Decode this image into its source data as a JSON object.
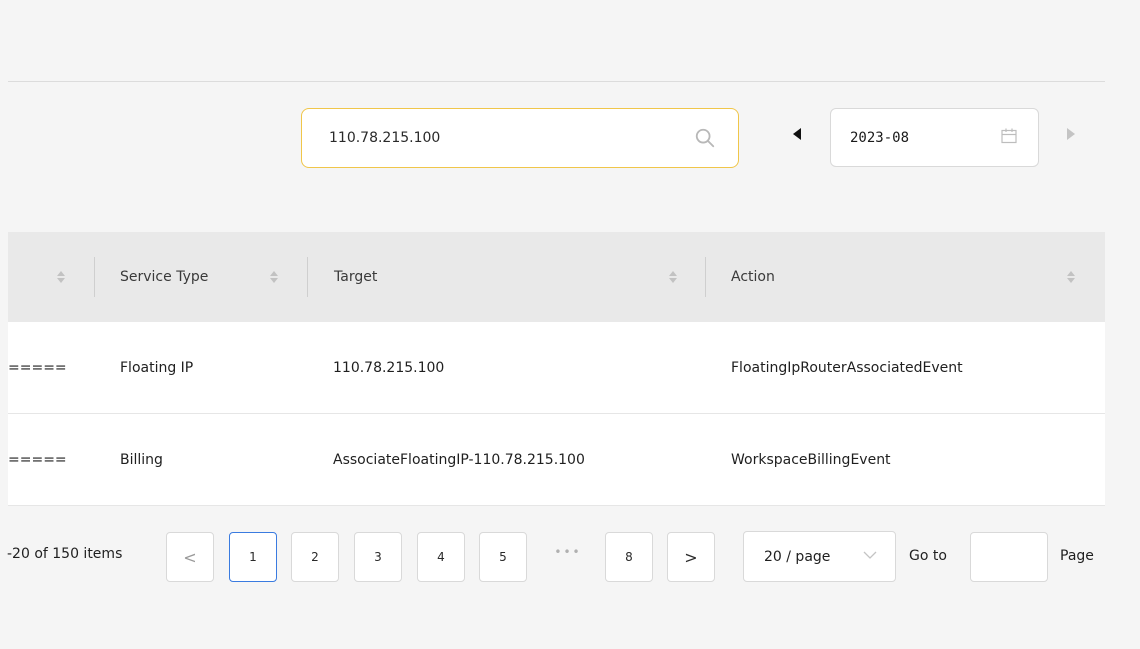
{
  "search": {
    "value": "110.78.215.100"
  },
  "date_picker": {
    "value": "2023-08"
  },
  "table": {
    "headers": [
      "Service Type",
      "Target",
      "Action"
    ],
    "rows": [
      {
        "prefix": "=====",
        "service_type": "Floating IP",
        "target": "110.78.215.100",
        "action": "FloatingIpRouterAssociatedEvent"
      },
      {
        "prefix": "=====",
        "service_type": "Billing",
        "target": "AssociateFloatingIP-110.78.215.100",
        "action": "WorkspaceBillingEvent"
      }
    ]
  },
  "pagination": {
    "total_text": "-20 of 150 items",
    "prev": "<",
    "next": ">",
    "pages": [
      "1",
      "2",
      "3",
      "4",
      "5"
    ],
    "ellipsis": "•••",
    "last_page": "8",
    "current_page": "1",
    "page_size": "20 / page",
    "goto_label": "Go to",
    "page_label": "Page"
  },
  "colors": {
    "search_border": "#f0c64a",
    "active_page_border": "#3a7be0"
  },
  "icons": [
    "search-icon",
    "calendar-icon",
    "caret-left-icon",
    "caret-right-icon",
    "sort-icon",
    "chevron-down-icon"
  ]
}
